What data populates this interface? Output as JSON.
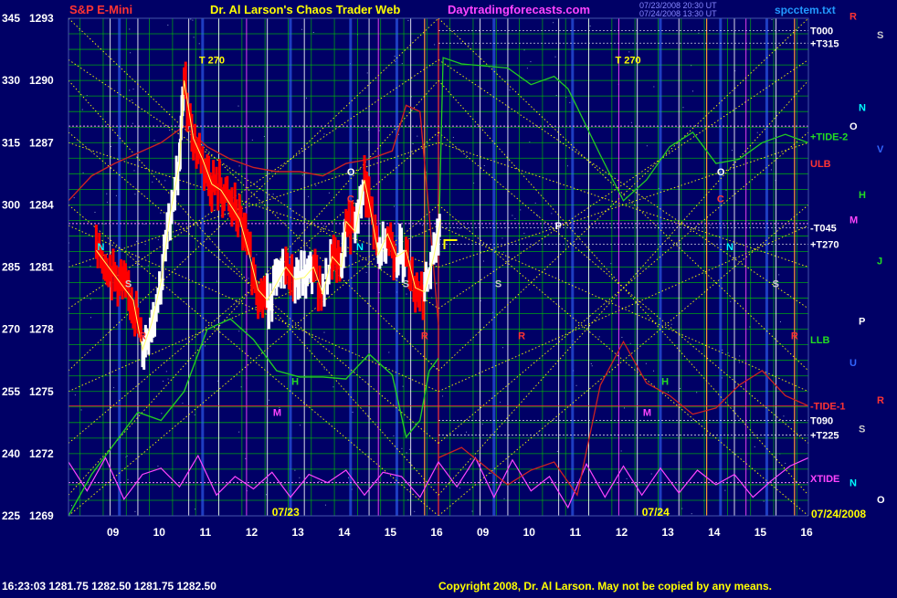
{
  "header": {
    "instrument": "S&P E-Mini",
    "title": "Dr. Al Larson's Chaos Trader Web",
    "site": "Daytradingforecasts.com",
    "timestamp_line1": "07/23/2008 20:30 UT",
    "timestamp_line2": "07/24/2008 13:30 UT",
    "corner": "spcctem.txt"
  },
  "footer": {
    "quote": "16:23:03  1281.75  1282.50  1281.75  1282.50",
    "copyright": "Copyright 2008, Dr. Al Larson. May not be copied by any means."
  },
  "colors": {
    "background": "#000066",
    "grid_green": "#00cc00",
    "white_vertical": "#ffffff",
    "blue_vertical": "#3366ff",
    "xgrid_yellow": "#ffff00",
    "price_up": "#ffffff",
    "price_down": "#ff0000",
    "ulb_red": "#cc2222",
    "llb_green": "#22cc22",
    "xtide_magenta": "#ff44ff",
    "tide_line": "#ff3333",
    "orange_vertical": "#ff9933"
  },
  "chart_data": {
    "type": "line",
    "title": "S&P E-Mini",
    "y_axis_left_ticks": [
      "345",
      "330",
      "315",
      "300",
      "285",
      "270",
      "255",
      "240",
      "225"
    ],
    "y_axis_price_ticks": [
      "1293",
      "1290",
      "1287",
      "1284",
      "1281",
      "1278",
      "1275",
      "1272",
      "1269"
    ],
    "ylim": [
      1269,
      1293
    ],
    "x_tick_labels": [
      "09",
      "10",
      "11",
      "12",
      "13",
      "14",
      "15",
      "16",
      "09",
      "10",
      "11",
      "12",
      "13",
      "14",
      "15",
      "16"
    ],
    "date_labels": [
      "07/23",
      "07/24",
      "07/24/2008"
    ],
    "grid": true,
    "right_labels": [
      {
        "text": "T000",
        "value": 1292.4,
        "color": "#ffffff"
      },
      {
        "text": "+T315",
        "value": 1291.8,
        "color": "#ffffff"
      },
      {
        "text": "+TIDE-2",
        "value": 1287.3,
        "color": "#22dd22"
      },
      {
        "text": "ULB",
        "value": 1286.0,
        "color": "#ff3333"
      },
      {
        "text": "-T045",
        "value": 1282.9,
        "color": "#ffffff"
      },
      {
        "text": "+T270",
        "value": 1282.1,
        "color": "#ffffff"
      },
      {
        "text": "LLB",
        "value": 1277.5,
        "color": "#22dd22"
      },
      {
        "text": "-TIDE-1",
        "value": 1274.3,
        "color": "#ff3333"
      },
      {
        "text": "T090",
        "value": 1273.6,
        "color": "#ffffff"
      },
      {
        "text": "+T225",
        "value": 1272.9,
        "color": "#ffffff"
      },
      {
        "text": "XTIDE",
        "value": 1270.8,
        "color": "#ff44ff"
      }
    ],
    "annotations": [
      {
        "text": "T 270",
        "x": "10.9",
        "value": 1291.0,
        "color": "#ffff00"
      },
      {
        "text": "T 270",
        "x": "11.9b",
        "value": 1291.0,
        "color": "#ffff00"
      },
      {
        "text": "O",
        "x": "14.1",
        "value": 1285.6,
        "color": "#ffffff"
      },
      {
        "text": "C",
        "x": "14.1",
        "value": 1284.3,
        "color": "#ff3333"
      },
      {
        "text": "N",
        "x": "8.7",
        "value": 1282.0,
        "color": "#00ffff"
      },
      {
        "text": "N",
        "x": "14.3",
        "value": 1282.0,
        "color": "#00ffff"
      },
      {
        "text": "P",
        "x": "10.6b",
        "value": 1283.0,
        "color": "#ffffff"
      },
      {
        "text": "M",
        "x": "12.5",
        "value": 1274.0,
        "color": "#ff44ff"
      },
      {
        "text": "M",
        "x": "12.5b",
        "value": 1274.0,
        "color": "#ff44ff"
      },
      {
        "text": "H",
        "x": "12.9",
        "value": 1275.5,
        "color": "#22dd22"
      },
      {
        "text": "H",
        "x": "12.9b",
        "value": 1275.5,
        "color": "#22dd22"
      },
      {
        "text": "R",
        "x": "9.6",
        "value": 1277.7,
        "color": "#ff3333"
      },
      {
        "text": "R",
        "x": "15.7",
        "value": 1277.7,
        "color": "#ff3333"
      },
      {
        "text": "R",
        "x": "9.8b",
        "value": 1277.7,
        "color": "#ff3333"
      },
      {
        "text": "R",
        "x": "15.7b",
        "value": 1277.7,
        "color": "#ff3333"
      },
      {
        "text": "S",
        "x": "9.3",
        "value": 1280.2,
        "color": "#cccccc"
      },
      {
        "text": "S",
        "x": "15.3",
        "value": 1280.2,
        "color": "#cccccc"
      },
      {
        "text": "S",
        "x": "9.3b",
        "value": 1280.2,
        "color": "#cccccc"
      },
      {
        "text": "S",
        "x": "15.3b",
        "value": 1280.2,
        "color": "#cccccc"
      },
      {
        "text": "O",
        "x": "14.1b",
        "value": 1285.6,
        "color": "#ffffff"
      },
      {
        "text": "C",
        "x": "14.1b",
        "value": 1284.3,
        "color": "#ff3333"
      },
      {
        "text": "N",
        "x": "14.3b",
        "value": 1282.0,
        "color": "#00ffff"
      }
    ],
    "far_right_glyphs": [
      {
        "text": "R",
        "value": 1293.1,
        "color": "#ff3333"
      },
      {
        "text": "S",
        "value": 1292.2,
        "color": "#cccccc"
      },
      {
        "text": "N",
        "value": 1288.7,
        "color": "#00ffff"
      },
      {
        "text": "O",
        "value": 1287.8,
        "color": "#ffffff"
      },
      {
        "text": "V",
        "value": 1286.7,
        "color": "#3366ff"
      },
      {
        "text": "H",
        "value": 1284.5,
        "color": "#22dd22"
      },
      {
        "text": "M",
        "value": 1283.3,
        "color": "#ff44ff"
      },
      {
        "text": "J",
        "value": 1281.3,
        "color": "#22dd22"
      },
      {
        "text": "P",
        "value": 1278.4,
        "color": "#ffffff"
      },
      {
        "text": "U",
        "value": 1276.4,
        "color": "#3366ff"
      },
      {
        "text": "R",
        "value": 1274.6,
        "color": "#ff3333"
      },
      {
        "text": "S",
        "value": 1273.2,
        "color": "#cccccc"
      },
      {
        "text": "N",
        "value": 1270.6,
        "color": "#00ffff"
      },
      {
        "text": "O",
        "value": 1269.8,
        "color": "#ffffff"
      }
    ],
    "price_series": {
      "name": "S&P E-Mini 5-min",
      "x_hours": [
        8.6,
        8.8,
        9.0,
        9.2,
        9.4,
        9.6,
        9.8,
        10.0,
        10.2,
        10.4,
        10.5,
        10.7,
        10.9,
        11.1,
        11.3,
        11.5,
        11.7,
        11.9,
        12.1,
        12.3,
        12.5,
        12.7,
        12.9,
        13.1,
        13.3,
        13.5,
        13.7,
        13.9,
        14.0,
        14.2,
        14.4,
        14.5,
        14.7,
        14.9,
        15.1,
        15.3,
        15.5,
        15.7,
        15.9,
        16.05
      ],
      "values": [
        1281.8,
        1281.2,
        1280.6,
        1280.0,
        1279.4,
        1277.0,
        1278.3,
        1280.3,
        1283.6,
        1286.0,
        1290.0,
        1287.2,
        1286.2,
        1285.0,
        1284.7,
        1284.0,
        1283.3,
        1281.7,
        1279.9,
        1279.4,
        1280.2,
        1281.0,
        1280.4,
        1280.5,
        1281.0,
        1279.7,
        1281.5,
        1281.0,
        1283.2,
        1282.7,
        1285.2,
        1284.1,
        1281.6,
        1282.6,
        1281.5,
        1281.8,
        1280.0,
        1279.8,
        1281.5,
        1283.3
      ]
    },
    "ulb_series": {
      "x_hours": [
        8.0,
        8.5,
        9.0,
        9.5,
        10.0,
        10.5,
        11.0,
        11.5,
        12.0,
        12.5,
        13.0,
        13.5,
        14.0,
        14.5,
        15.0,
        15.3,
        15.6,
        15.8,
        16.0
      ],
      "values": [
        1284.2,
        1285.4,
        1286.0,
        1286.5,
        1287.0,
        1287.8,
        1286.8,
        1286.2,
        1285.8,
        1285.6,
        1285.6,
        1285.4,
        1286.0,
        1286.2,
        1286.6,
        1288.8,
        1288.5,
        1283.5,
        1278.2
      ]
    },
    "llb_series": {
      "x_hours": [
        8.0,
        8.5,
        9.0,
        9.5,
        10.0,
        10.5,
        11.0,
        11.5,
        12.0,
        12.5,
        13.0,
        13.5,
        14.0,
        14.5,
        15.0,
        15.3,
        15.6,
        15.8,
        16.0
      ],
      "values": [
        1269.0,
        1271.0,
        1272.5,
        1274.0,
        1273.6,
        1275.0,
        1278.0,
        1278.5,
        1277.5,
        1276.0,
        1275.7,
        1275.7,
        1275.6,
        1276.8,
        1275.8,
        1272.8,
        1273.6,
        1276.0,
        1276.6
      ]
    },
    "projection_green": {
      "x_hours": [
        16.0,
        16.1,
        16.5,
        17.5,
        18.0,
        18.5,
        18.8,
        19.0,
        19.5,
        20.0,
        20.5,
        21.0,
        21.5,
        22.0,
        22.5,
        23.0,
        23.5,
        24.0
      ],
      "values": [
        1281.8,
        1291.1,
        1290.8,
        1290.6,
        1289.8,
        1290.2,
        1289.6,
        1288.7,
        1286.4,
        1284.2,
        1285.2,
        1286.8,
        1287.5,
        1286.0,
        1286.2,
        1287.0,
        1287.4,
        1287.0
      ]
    },
    "projection_red": {
      "x_hours": [
        16.0,
        16.5,
        17.0,
        17.5,
        18.0,
        18.5,
        19.0,
        19.5,
        20.0,
        20.5,
        21.0,
        21.5,
        22.0,
        22.5,
        23.0,
        23.5,
        24.0
      ],
      "values": [
        1271.8,
        1272.3,
        1271.4,
        1270.5,
        1271.2,
        1271.6,
        1270.0,
        1275.3,
        1277.4,
        1275.4,
        1274.8,
        1273.9,
        1274.2,
        1275.3,
        1276.0,
        1274.8,
        1274.3
      ]
    },
    "xtide_series": {
      "x_hours": [
        8.0,
        8.4,
        8.8,
        9.2,
        9.6,
        10.0,
        10.4,
        10.8,
        11.2,
        11.6,
        12.0,
        12.4,
        12.8,
        13.2,
        13.6,
        14.0,
        14.4,
        14.8,
        15.2,
        15.6,
        16.0,
        16.4,
        16.8,
        17.2,
        17.6,
        18.0,
        18.4,
        18.8,
        19.2,
        19.6,
        20.0,
        20.4,
        20.8,
        21.2,
        21.6,
        22.0,
        22.4,
        22.8,
        23.2,
        23.6,
        24.0
      ],
      "values": [
        1271.6,
        1270.2,
        1271.8,
        1269.8,
        1271.0,
        1271.3,
        1270.4,
        1271.9,
        1270.0,
        1270.9,
        1270.3,
        1271.1,
        1269.9,
        1271.0,
        1270.6,
        1271.2,
        1270.0,
        1271.1,
        1270.9,
        1269.9,
        1271.6,
        1270.4,
        1271.8,
        1269.9,
        1271.7,
        1270.2,
        1270.9,
        1269.4,
        1271.5,
        1269.9,
        1271.4,
        1270.0,
        1271.3,
        1270.1,
        1271.2,
        1270.5,
        1271.0,
        1269.9,
        1270.7,
        1271.4,
        1271.8
      ]
    }
  }
}
